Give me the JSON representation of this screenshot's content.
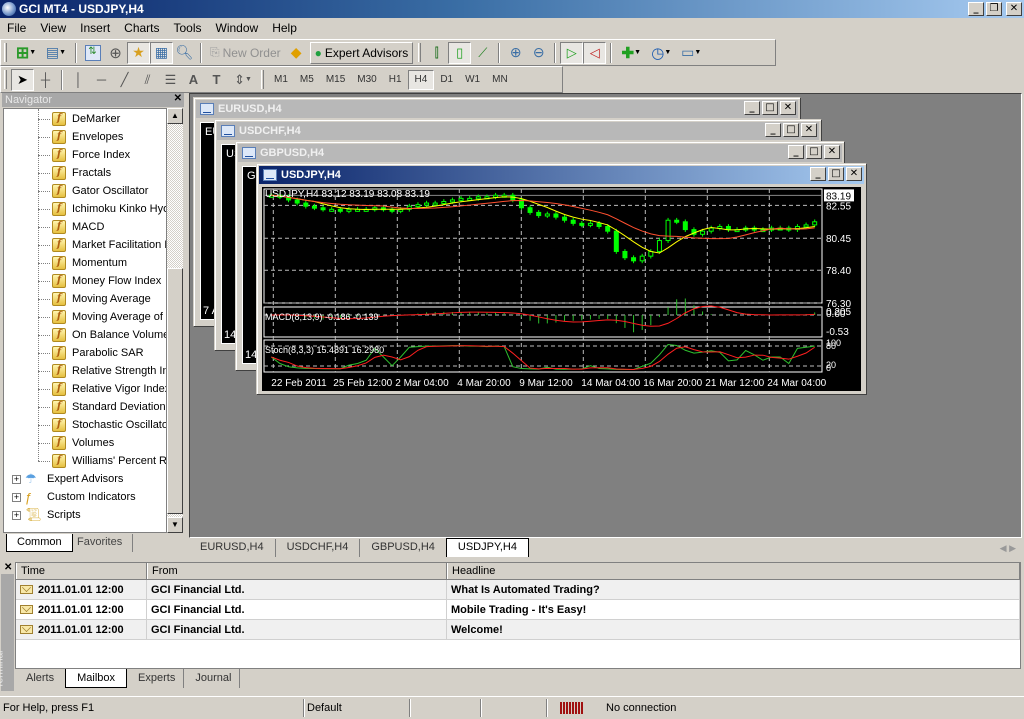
{
  "app": {
    "title": "GCI MT4 - USDJPY,H4"
  },
  "menu": [
    "File",
    "View",
    "Insert",
    "Charts",
    "Tools",
    "Window",
    "Help"
  ],
  "toolbar": {
    "new_order_label": "New Order",
    "expert_advisors_label": "Expert Advisors",
    "timeframes": [
      "M1",
      "M5",
      "M15",
      "M30",
      "H1",
      "H4",
      "D1",
      "W1",
      "MN"
    ],
    "active_timeframe": "H4"
  },
  "navigator": {
    "title": "Navigator",
    "indicators": [
      "DeMarker",
      "Envelopes",
      "Force Index",
      "Fractals",
      "Gator Oscillator",
      "Ichimoku Kinko Hyo",
      "MACD",
      "Market Facilitation I",
      "Momentum",
      "Money Flow Index",
      "Moving Average",
      "Moving Average of",
      "On Balance Volume",
      "Parabolic SAR",
      "Relative Strength In",
      "Relative Vigor Index",
      "Standard Deviation",
      "Stochastic Oscillator",
      "Volumes",
      "Williams' Percent Ra"
    ],
    "groups": [
      "Expert Advisors",
      "Custom Indicators",
      "Scripts"
    ],
    "tabs": [
      "Common",
      "Favorites"
    ],
    "active_tab": "Common"
  },
  "chart_windows": [
    {
      "title": "EURUSD,H4",
      "label_fragment": "EU",
      "time_fragment": "7 A"
    },
    {
      "title": "USDCHF,H4",
      "label_fragment": "US",
      "time_fragment": "14 I"
    },
    {
      "title": "GBPUSD,H4",
      "label_fragment": "GB",
      "time_fragment": "14 I"
    },
    {
      "title": "USDJPY,H4"
    }
  ],
  "chart_tabs": [
    "EURUSD,H4",
    "USDCHF,H4",
    "GBPUSD,H4",
    "USDJPY,H4"
  ],
  "active_chart_tab": "USDJPY,H4",
  "chart_data": {
    "type": "candlestick",
    "symbol": "USDJPY",
    "timeframe": "H4",
    "ohlc_label": "USDJPY,H4  83.12 83.19 83.08 83.19",
    "current_price": "83.19",
    "price_ticks": [
      "82.55",
      "80.45",
      "78.40",
      "76.30"
    ],
    "ylim": [
      76.3,
      83.6
    ],
    "x_tick_labels": [
      "22 Feb 2011",
      "25 Feb 12:00",
      "2 Mar 04:00",
      "4 Mar 20:00",
      "9 Mar 12:00",
      "14 Mar 04:00",
      "16 Mar 20:00",
      "21 Mar 12:00",
      "24 Mar 04:00"
    ],
    "close_series": [
      83.2,
      83.1,
      82.9,
      82.7,
      82.5,
      82.4,
      82.3,
      82.3,
      82.2,
      82.3,
      82.3,
      82.3,
      82.4,
      82.3,
      82.2,
      82.3,
      82.5,
      82.6,
      82.7,
      82.7,
      82.8,
      82.9,
      83.0,
      83.0,
      83.1,
      83.1,
      83.2,
      83.2,
      82.9,
      82.4,
      82.1,
      81.9,
      82.0,
      81.8,
      81.6,
      81.4,
      81.3,
      81.4,
      81.2,
      80.9,
      79.6,
      79.2,
      79.0,
      79.3,
      79.6,
      80.3,
      81.6,
      81.5,
      81.0,
      80.7,
      80.9,
      81.1,
      81.2,
      81.0,
      81.0,
      81.1,
      81.0,
      81.0,
      81.1,
      81.1,
      81.0,
      81.2,
      81.3,
      81.5
    ],
    "ma_fast_color": "#ffff00",
    "ma_slow_color": "#ff5030",
    "candle_color": "#00ff00",
    "macd": {
      "label": "MACD(8,13,9) -0.186 -0.139",
      "ticks": [
        "0.205",
        "0.00",
        "-0.53"
      ]
    },
    "stoch": {
      "label": "Stoch(8,3,3) 15.4891 16.2980",
      "ticks": [
        "100",
        "80",
        "20",
        "0"
      ]
    }
  },
  "terminal": {
    "side_label": "Terminal",
    "columns": [
      "Time",
      "From",
      "Headline"
    ],
    "rows": [
      {
        "time": "2011.01.01 12:00",
        "from": "GCI Financial Ltd.",
        "headline": "What Is Automated Trading?"
      },
      {
        "time": "2011.01.01 12:00",
        "from": "GCI Financial Ltd.",
        "headline": "Mobile Trading - It's Easy!"
      },
      {
        "time": "2011.01.01 12:00",
        "from": "GCI Financial Ltd.",
        "headline": "Welcome!"
      }
    ],
    "tabs": [
      "Alerts",
      "Mailbox",
      "Experts",
      "Journal"
    ],
    "active_tab": "Mailbox"
  },
  "status": {
    "help": "For Help, press F1",
    "profile": "Default",
    "connection": "No connection"
  }
}
